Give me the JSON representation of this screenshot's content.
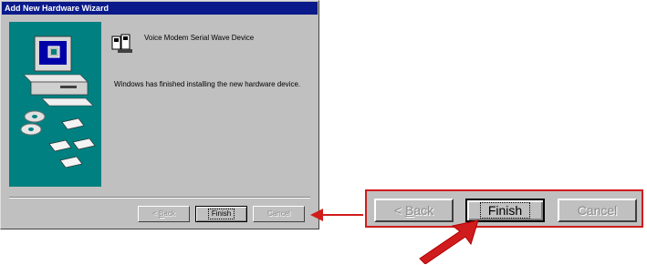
{
  "window": {
    "title": "Add New Hardware Wizard"
  },
  "device": {
    "name": "Voice Modem Serial Wave Device",
    "icon": "modem-device-icon"
  },
  "message": "Windows has finished installing the new hardware device.",
  "buttons": {
    "back_prefix": "< ",
    "back_accel": "B",
    "back_rest": "ack",
    "finish": "Finish",
    "cancel": "Cancel"
  },
  "colors": {
    "title_bar": "#0a1a8a",
    "dialog_face": "#c0c0c0",
    "side_panel": "#008080",
    "highlight": "#d01c1c"
  }
}
